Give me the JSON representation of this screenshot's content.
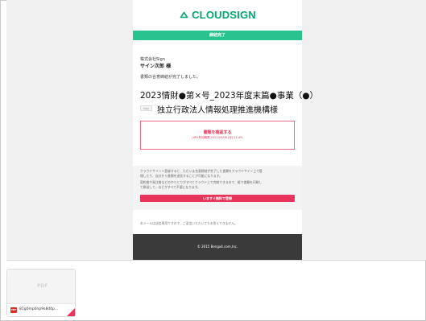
{
  "email": {
    "logo_text": "CLOUDSIGN",
    "banner": "締結完了",
    "company": "株式会社Sign",
    "recipient": "サイン次郎 様",
    "completed_message": "書類の合意締結が完了しました。",
    "document_title": "2023情財●第×号_2023年度末篇●事業（●）",
    "sender_tag": "Sign",
    "sender_name": "独立行政法人情報処理推進機構様",
    "confirm_title": "書類を確認する",
    "confirm_sub": "(URL有効期限 2021/03/08 (月) 21:49)",
    "promo_lines": [
      "クラウドサインへ登録すると、ただいま合意締結が完了した書類をクラウドサイン上で管",
      "理したり、自分から書類を送信することが可能になります。",
      "契約書や発注書などのやりとりがすべてクラウド上で完結できるので、紙で書類を印刷し",
      "て郵送して…などがすべて不要になります。"
    ],
    "signup_button": "いますぐ無料で登録",
    "notice": "本メールは送信専用ですので、ご返信いただいてもお答えできません。",
    "footer": "© 2015 Bengo4.com,Inc."
  },
  "attachment": {
    "thumb_label": "PDF",
    "type_icon": "PDF",
    "filename": "81g0mp0np9s8d4p..."
  },
  "colors": {
    "brand_green": "#29c38f",
    "accent_pink": "#e8335a",
    "footer_dark": "#3a3a3a"
  }
}
